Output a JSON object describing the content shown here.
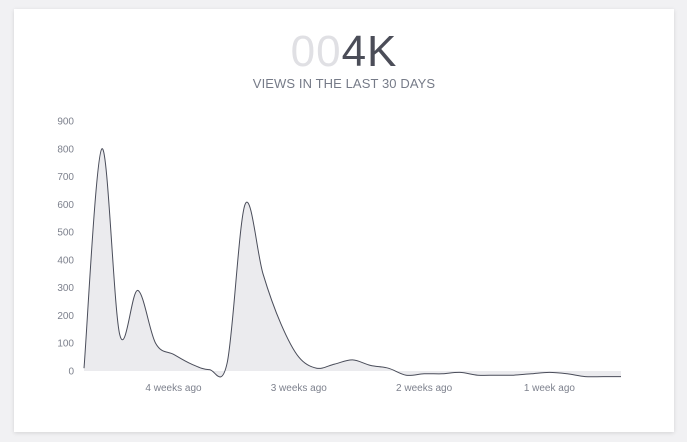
{
  "widget": {
    "stat_padding": "00",
    "stat_value": "4K",
    "subtitle": "VIEWS IN THE LAST 30 DAYS"
  },
  "colors": {
    "line": "#4a4d5a",
    "area_fill": "#ebebee",
    "axis_text": "#7d818d",
    "stat_pad": "#e0e0e4",
    "stat_value": "#4b4d58"
  },
  "chart_data": {
    "type": "area",
    "title": "",
    "xlabel": "",
    "ylabel": "",
    "ylim": [
      0,
      900
    ],
    "yticks": [
      0,
      100,
      200,
      300,
      400,
      500,
      600,
      700,
      800,
      900
    ],
    "xlim": [
      0,
      30
    ],
    "xticks": [
      {
        "x": 5,
        "label": "4 weeks ago"
      },
      {
        "x": 12,
        "label": "3 weeks ago"
      },
      {
        "x": 19,
        "label": "2 weeks ago"
      },
      {
        "x": 26,
        "label": "1 week ago"
      }
    ],
    "grid": false,
    "legend": "none",
    "series": [
      {
        "x": [
          0,
          1,
          2,
          3,
          4,
          5,
          6,
          7,
          8,
          9,
          10,
          11,
          12,
          13,
          14,
          15,
          16,
          17,
          18,
          19,
          20,
          21,
          22,
          23,
          24,
          25,
          26,
          27,
          28,
          29,
          30
        ],
        "values": [
          10,
          800,
          130,
          290,
          100,
          60,
          25,
          5,
          30,
          600,
          350,
          170,
          50,
          10,
          25,
          40,
          20,
          10,
          -15,
          -10,
          -10,
          -5,
          -15,
          -15,
          -15,
          -10,
          -5,
          -10,
          -20,
          -20,
          -20
        ]
      }
    ]
  }
}
